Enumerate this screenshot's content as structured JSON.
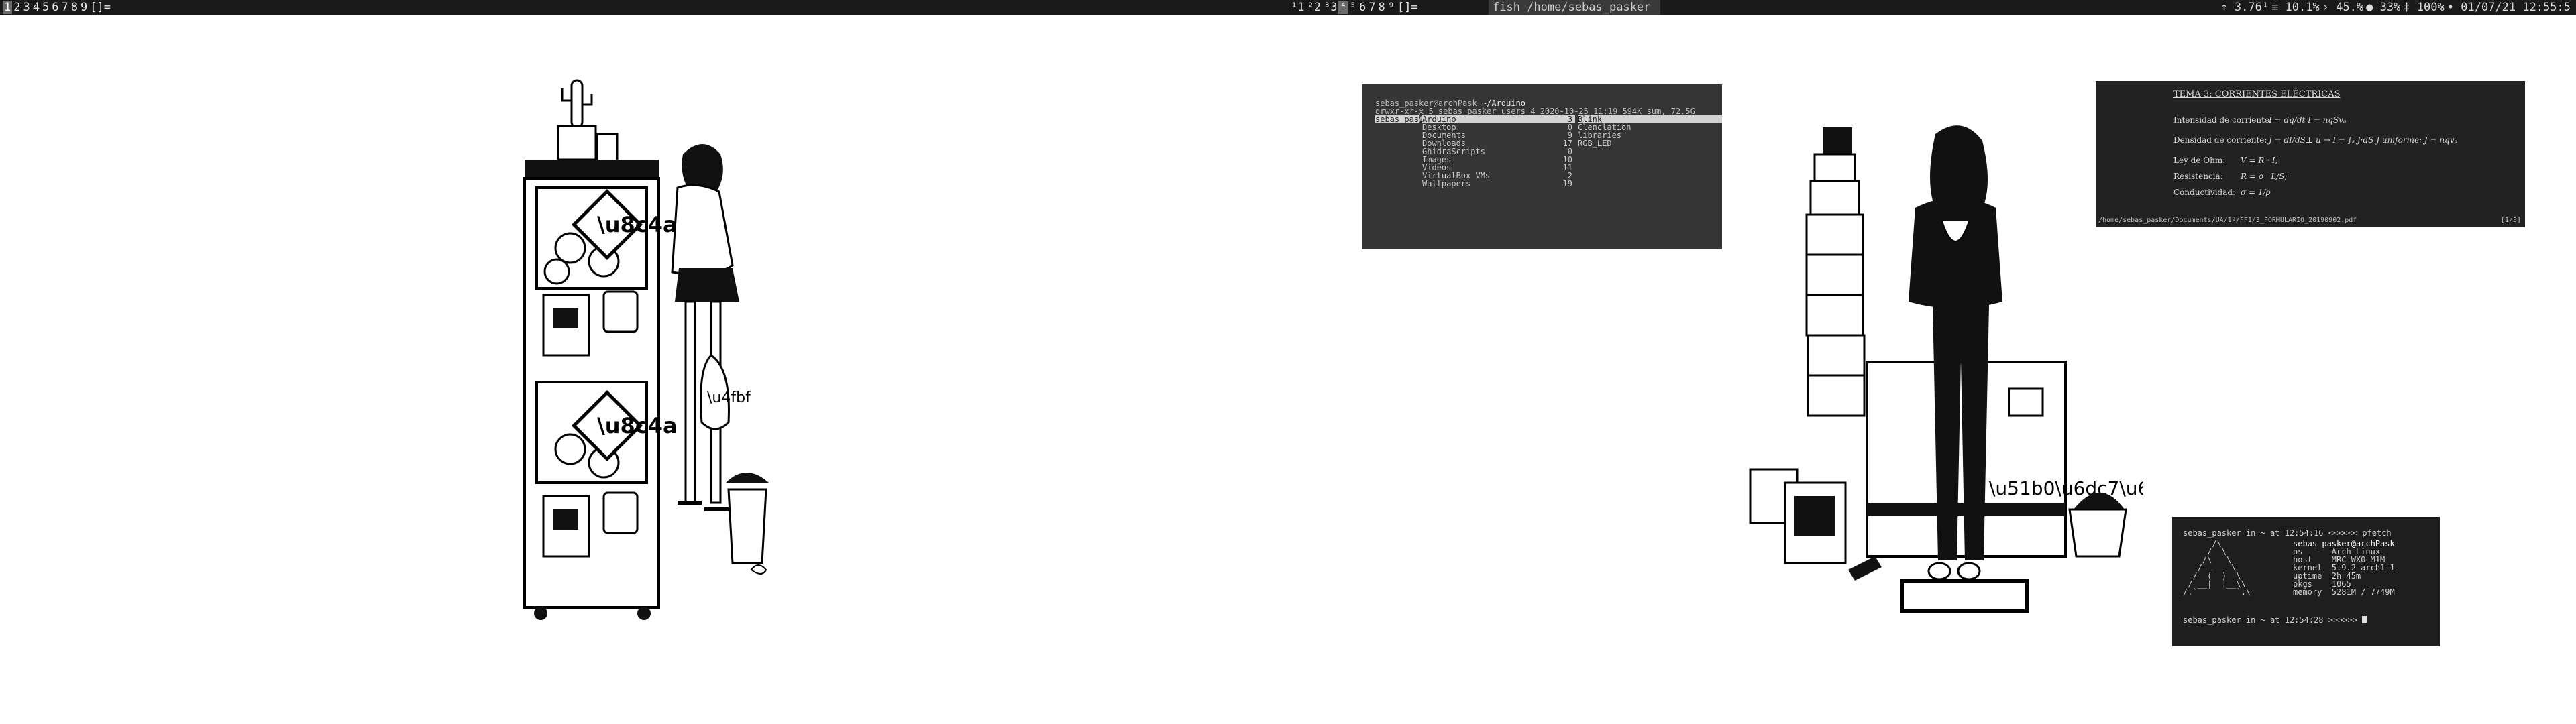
{
  "bar": {
    "workspaces_left": [
      "1",
      "2",
      "3",
      "4",
      "5",
      "6",
      "7",
      "8",
      "9",
      "[]="
    ],
    "workspaces_mid": [
      "¹1",
      "²2",
      "³3",
      "⁴",
      "⁵",
      "6",
      "7",
      "8",
      "⁹",
      "[]="
    ],
    "window_title": "fish /home/sebas_pasker",
    "status": [
      "↑ 3.76¹",
      "≡ 10.1%",
      "› 45.%",
      "● 33%",
      "‡ 100%",
      "∙ 01/07/21 12:55:5"
    ]
  },
  "ranger": {
    "title_user": "sebas_pasker@archPask",
    "title_path": "~/Arduino",
    "info": "drwxr-xr-x 5 sebas_pasker users 4 2020-10-25 11:19   594K sum, 72.5G free  1/9  All",
    "parent": [
      "sebas_pas"
    ],
    "current": [
      {
        "name": "Arduino",
        "count": "3"
      },
      {
        "name": "Desktop",
        "count": "0"
      },
      {
        "name": "Documents",
        "count": "9"
      },
      {
        "name": "Downloads",
        "count": "17"
      },
      {
        "name": "GhidraScripts",
        "count": "0"
      },
      {
        "name": "Images",
        "count": "10"
      },
      {
        "name": "Videos",
        "count": "11"
      },
      {
        "name": "VirtualBox VMs",
        "count": "2"
      },
      {
        "name": "Wallpapers",
        "count": "19"
      }
    ],
    "preview": [
      "Blink",
      "Clenclation",
      "libraries",
      "RGB_LED"
    ]
  },
  "pdf": {
    "title": "TEMA 3: CORRIENTES ELÉCTRICAS",
    "lines": [
      {
        "label": "Intensidad de corriente:",
        "formula": "I = dq/dt      I = nqSvₐ"
      },
      {
        "label": "Densidad de corriente:",
        "formula": "J = dI/dS⊥ u   ⇒   I = ∫ₛ J·dS      J uniforme:  J = nqvₐ"
      },
      {
        "label": "Ley de Ohm:",
        "formula": "V = R · I;"
      },
      {
        "label": "Resistencia:",
        "formula": "R = ρ · L/S;"
      },
      {
        "label": "Conductividad:",
        "formula": "σ = 1/ρ"
      }
    ],
    "path": "/home/sebas_pasker/Documents/UA/1º/FF1/3_FORMULARIO_20190902.pdf",
    "page": "[1/3]"
  },
  "terminal": {
    "prompt1": "sebas_pasker in ~ at 12:54:16 <<<<<< pfetch",
    "logo": [
      "      /\\",
      "     /  \\",
      "    /\\   \\",
      "   /  __  \\",
      "  /  (  )  \\",
      " / __|  |__\\\\",
      "/.`        `.\\"
    ],
    "info": [
      "sebas_pasker@archPask",
      "os      Arch Linux",
      "host    MRC-WX0 M1M",
      "kernel  5.9.2-arch1-1",
      "uptime  2h 45m",
      "pkgs    1065",
      "memory  5281M / 7749M"
    ],
    "prompt2": "sebas_pasker in ~ at 12:54:28 >>>>>> "
  }
}
